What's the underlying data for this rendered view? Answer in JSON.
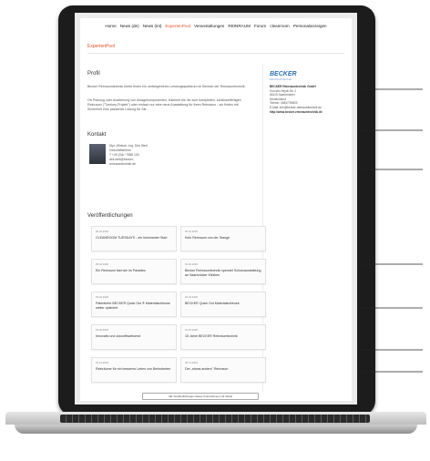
{
  "nav": {
    "items": [
      "Home",
      "News (de)",
      "News (int)",
      "ExpertenPool",
      "Veranstaltungen",
      "REINRAUM",
      "Forum",
      "cleanroom",
      "Personalanzeigen"
    ],
    "active_index": 3
  },
  "breadcrumb": "ExpertenPool",
  "profile": {
    "heading": "Profil",
    "paragraph1": "Becker Reinraumtechnik bietet Ihnen ein umfangreiches Leistungsspektrum im Bereich der Reinraumtechnik.",
    "paragraph2": "Ob Planung oder Ausführung von Anlagekomponenten, Kabinen bis hin zum kompletten, schlüsselfertigen Reinraum (\"Turnkey-Projekt\") oder einfach nur eine neue Ausstattung für Ihren Reinraum - wir finden mit Sicherheit eine passende Lösung für Sie."
  },
  "contact": {
    "heading": "Kontakt",
    "lines": [
      "Dipl.-Wirtsch.-Ing. Dirk Steil",
      "Geschäftsführer",
      "T +49 (0)6 / 7588 100",
      "dirk.steil@becker-",
      "reinraumtechnik.de"
    ]
  },
  "sidebar": {
    "logo": "BECKER",
    "logo_sub": "REINRAUMTECHNIK",
    "company": "BECKER Reinraumtechnik GmbH",
    "address": [
      "Von-der-Heydt-Str. 2",
      "66115 Saarbrücken",
      "Deutschland",
      "Telefon: 0681/759600",
      "E-Mail: info@becker-reinraumtechnik.de"
    ],
    "website": "http://www.becker-reinraumtechnik.de"
  },
  "publications": {
    "heading": "Veröffentlichungen",
    "items": [
      {
        "date": "06.02.2020",
        "title": "CLEANROOM TUESDAYS - ein fulminanter Start"
      },
      {
        "date": "05.02.2020",
        "title": "Kein Reinraum von der Stange"
      },
      {
        "date": "05.02.2020",
        "title": "Ein Reinraum fast wie im Paradies"
      },
      {
        "date": "04.02.2020",
        "title": "Becker Reinraumtechnik spendet Schutzausstattung an Saarbrücker Kliniken"
      },
      {
        "date": "03.02.2020",
        "title": "Patentierte BECKER Quick Out ® Materialschleuse weiter optimiert"
      },
      {
        "date": "02.02.2020",
        "title": "BECKER Quick Out Materialschleuse"
      },
      {
        "date": "01.02.2020",
        "title": "Innovativ und zukunftsweisend"
      },
      {
        "date": "01.01.2020",
        "title": "15 Jahre BECKER Reinraumtechnik"
      },
      {
        "date": "31.12.2019",
        "title": "Reinräume für ein besseres Leben von Behinderten"
      },
      {
        "date": "30.12.2019",
        "title": "Der „etwas andere\" Reinraum"
      }
    ],
    "more_button": "Alle Veröffentlichungen dieses Unternehmens (14 Stück)"
  }
}
